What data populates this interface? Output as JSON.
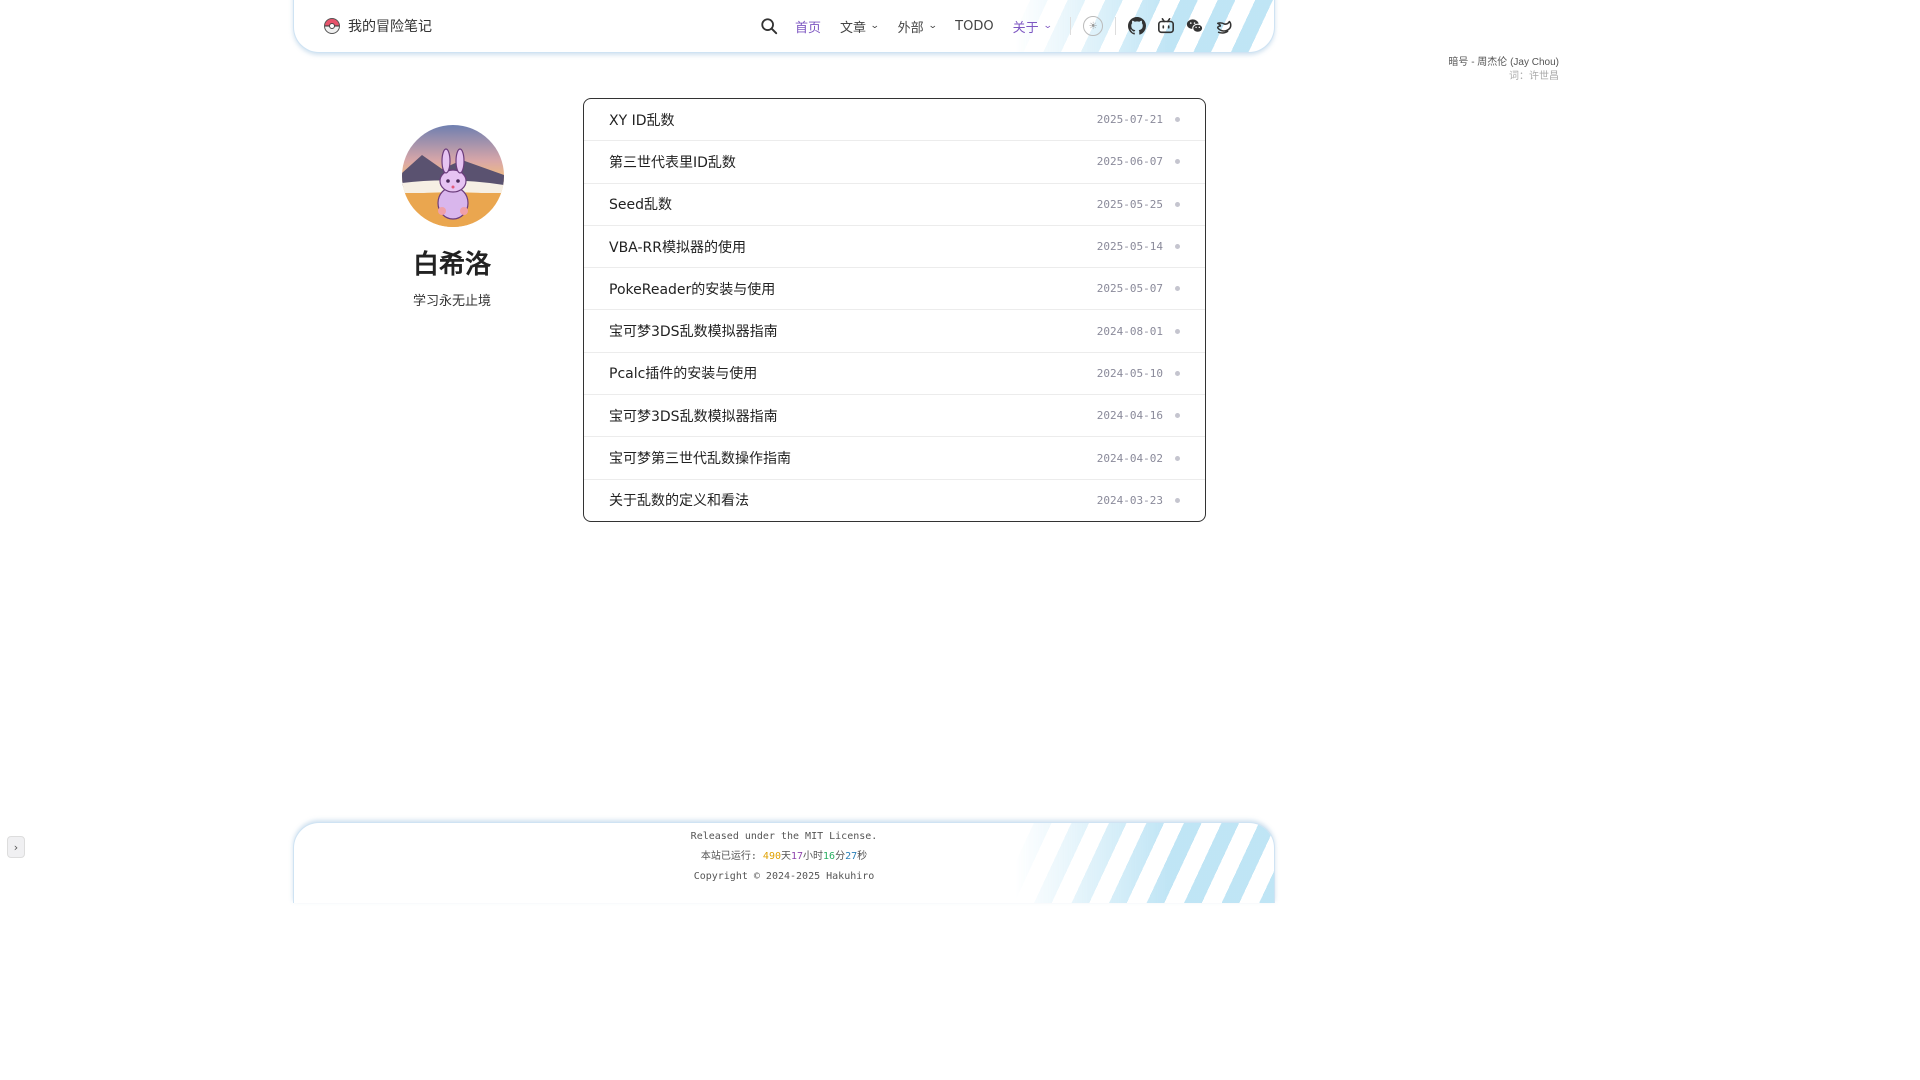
{
  "header": {
    "site_title": "我的冒险笔记",
    "nav": [
      {
        "label": "首页",
        "active": true,
        "dropdown": false
      },
      {
        "label": "文章",
        "active": false,
        "dropdown": true
      },
      {
        "label": "外部",
        "active": false,
        "dropdown": true
      },
      {
        "label": "TODO",
        "active": false,
        "dropdown": false
      },
      {
        "label": "关于",
        "active": false,
        "dropdown": true
      }
    ],
    "icons": [
      "search-icon",
      "theme-toggle-icon",
      "github-icon",
      "bilibili-icon",
      "wechat-icon",
      "bird-icon"
    ],
    "accent_color": "#7e57c2"
  },
  "music": {
    "song": "暗号 - 周杰伦 (Jay Chou)",
    "lyric": "词：许世昌"
  },
  "profile": {
    "name": "白希洛",
    "motto": "学习永无止境"
  },
  "posts": [
    {
      "title": "XY ID乱数",
      "date": "2025-07-21"
    },
    {
      "title": "第三世代表里ID乱数",
      "date": "2025-06-07"
    },
    {
      "title": "Seed乱数",
      "date": "2025-05-25"
    },
    {
      "title": "VBA-RR模拟器的使用",
      "date": "2025-05-14"
    },
    {
      "title": "PokeReader的安装与使用",
      "date": "2025-05-07"
    },
    {
      "title": "宝可梦3DS乱数模拟器指南",
      "date": "2024-08-01"
    },
    {
      "title": "Pcalc插件的安装与使用",
      "date": "2024-05-10"
    },
    {
      "title": "宝可梦3DS乱数模拟器指南",
      "date": "2024-04-16"
    },
    {
      "title": "宝可梦第三世代乱数操作指南",
      "date": "2024-04-02"
    },
    {
      "title": "关于乱数的定义和看法",
      "date": "2024-03-23"
    }
  ],
  "footer": {
    "license": "Released under the MIT License.",
    "runtime_prefix": "本站已运行: ",
    "days": "490",
    "days_unit": "天",
    "hours": "17",
    "hours_unit": "小时",
    "minutes": "16",
    "minutes_unit": "分",
    "seconds": "27",
    "seconds_unit": "秒",
    "copyright": "Copyright © 2024-2025 Hakuhiro"
  }
}
